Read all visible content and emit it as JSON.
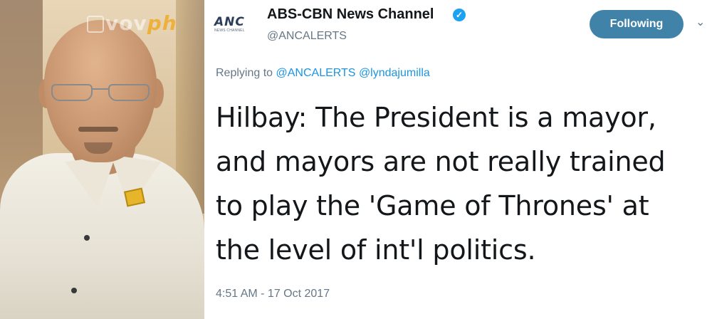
{
  "photo": {
    "watermark": "vov",
    "watermark_suffix": "ph"
  },
  "account": {
    "logo_mark": "ANC",
    "logo_sub": "NEWS CHANNEL",
    "name": "ABS-CBN News Channel",
    "handle": "@ANCALERTS",
    "verified": true
  },
  "follow_button": {
    "label": "Following",
    "color": "#4183a8"
  },
  "reply": {
    "prefix": "Replying to",
    "mentions": [
      "@ANCALERTS",
      "@lyndajumilla"
    ]
  },
  "tweet": {
    "lines": [
      "Hilbay: The President is a mayor,",
      "and mayors are not really trained",
      "to play the 'Game of Thrones' at",
      "the level of int'l politics."
    ],
    "timestamp": "4:51 AM - 17 Oct 2017"
  },
  "icons": {
    "verified": "verified-check-icon",
    "caret": "chevron-down-icon"
  },
  "colors": {
    "link": "#1b95e0",
    "verified": "#1da1f2",
    "secondary_text": "#657786"
  }
}
